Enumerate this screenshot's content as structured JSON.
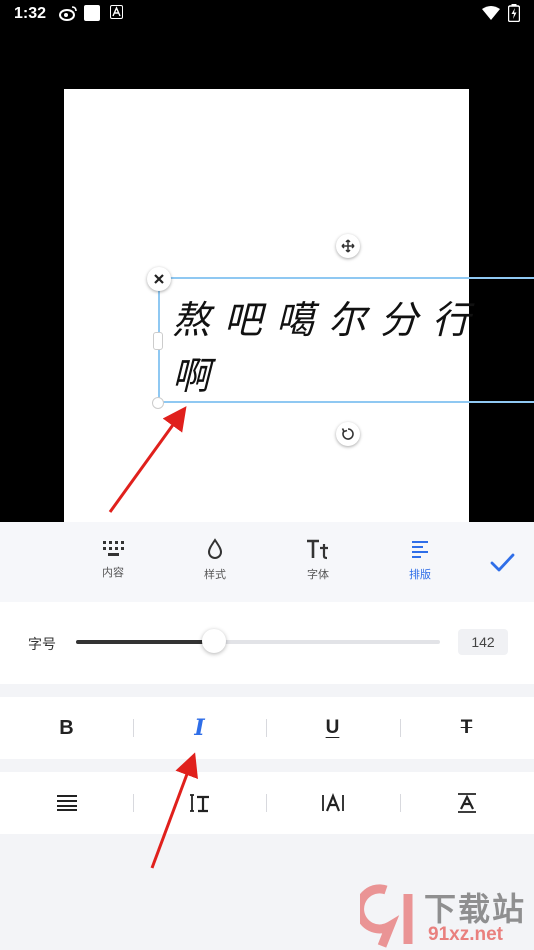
{
  "status_bar": {
    "time": "1:32"
  },
  "canvas": {
    "text_line_1": "熬吧噶尔分行",
    "text_line_2": "啊"
  },
  "toolbar": {
    "tabs": [
      {
        "label": "内容",
        "icon": "grid-icon"
      },
      {
        "label": "样式",
        "icon": "drop-icon"
      },
      {
        "label": "字体",
        "icon": "font-icon"
      },
      {
        "label": "排版",
        "icon": "align-left-icon",
        "active": true
      }
    ],
    "confirm_icon": "check-icon"
  },
  "font_size": {
    "label": "字号",
    "value": "142",
    "level_fraction": 0.38
  },
  "format_buttons": [
    {
      "name": "bold",
      "label": "B"
    },
    {
      "name": "italic",
      "label": "I",
      "active": true
    },
    {
      "name": "underline",
      "label": "U"
    },
    {
      "name": "strikethrough",
      "label": "T"
    }
  ],
  "spacing_buttons": [
    "justify-icon",
    "line-spacing-icon",
    "letter-spacing-icon",
    "overline-icon"
  ],
  "colors": {
    "accent": "#2f6ee8",
    "selection": "#8fc8f2",
    "annotation": "#e0201c"
  },
  "watermark": {
    "site": "下载站",
    "domain": "91xz.net"
  }
}
